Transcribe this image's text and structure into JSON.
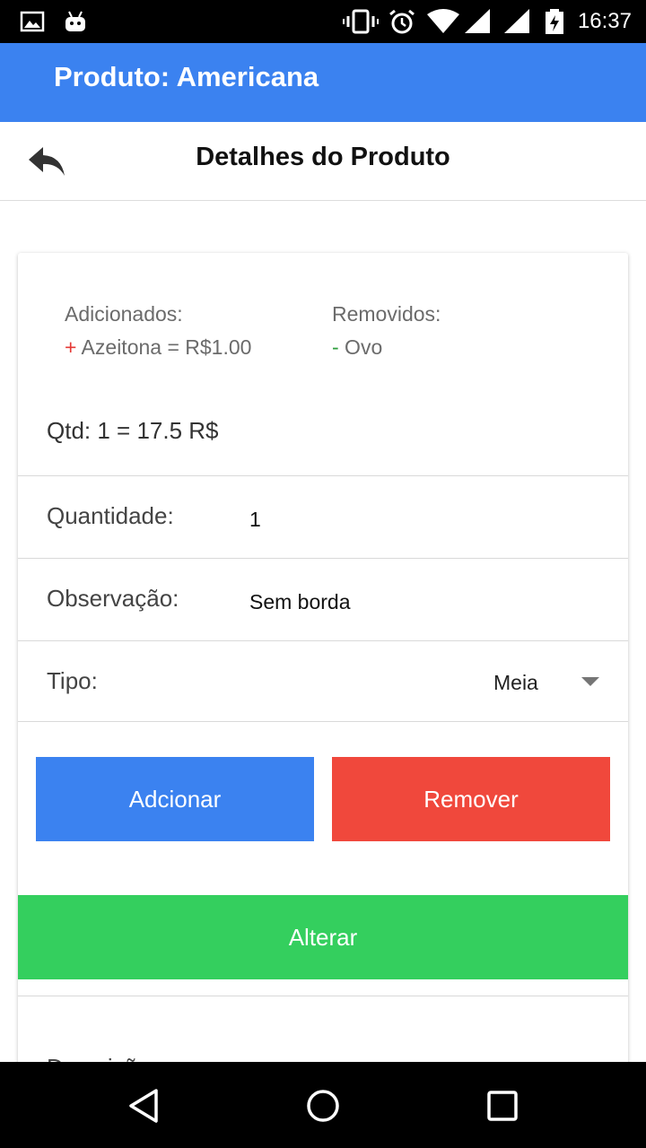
{
  "status_bar": {
    "time": "16:37",
    "icons": [
      "image-icon",
      "android-icon",
      "vibrate-icon",
      "alarm-icon",
      "wifi-icon",
      "signal-icon",
      "signal-icon",
      "battery-charging-icon"
    ]
  },
  "app_bar": {
    "title": "Produto: Americana"
  },
  "header": {
    "title": "Detalhes do Produto"
  },
  "card": {
    "added": {
      "label": "Adicionados:",
      "sign": "+",
      "item": " Azeitona = R$1.00"
    },
    "removed": {
      "label": "Removidos:",
      "sign": "-",
      "item": " Ovo"
    },
    "qty_total": "Qtd: 1 = 17.5 R$",
    "quantity": {
      "label": "Quantidade:",
      "value": "1"
    },
    "observation": {
      "label": "Observação:",
      "value": "Sem borda"
    },
    "type": {
      "label": "Tipo:",
      "selected": "Meia"
    },
    "buttons": {
      "add": "Adcionar",
      "remove": "Remover",
      "alter": "Alterar"
    },
    "description_label": "Descrição:"
  },
  "colors": {
    "primary": "#3b82f0",
    "danger": "#f0483c",
    "success": "#34cf5e",
    "plus_sign": "#e53935",
    "minus_sign": "#2e9e3e"
  }
}
